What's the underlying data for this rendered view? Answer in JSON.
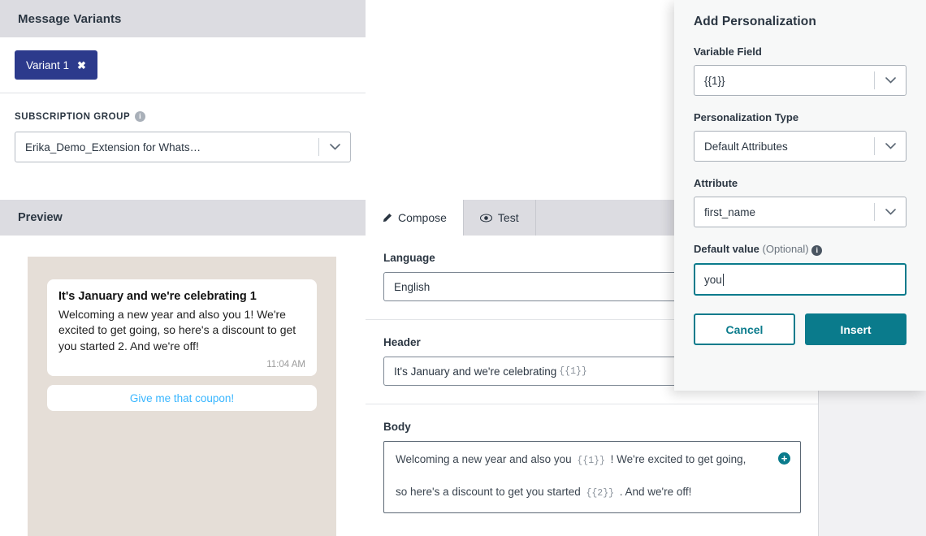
{
  "left": {
    "header_title": "Message Variants",
    "variant_chip": {
      "label": "Variant 1",
      "close_glyph": "✖"
    },
    "subscription": {
      "label": "SUBSCRIPTION GROUP",
      "info_glyph": "i",
      "selected": "Erika_Demo_Extension for Whats…"
    },
    "preview": {
      "title": "Preview",
      "message": {
        "header": "It's January and we're celebrating 1",
        "body": "Welcoming a new year and also you 1! We're excited to get going, so here's a discount to get you started 2. And we're off!",
        "time": "11:04 AM"
      },
      "button_label": "Give me that coupon!"
    }
  },
  "compose": {
    "tabs": [
      {
        "label": "Compose",
        "icon": "pencil-icon",
        "active": true
      },
      {
        "label": "Test",
        "icon": "eye-icon",
        "active": false
      }
    ],
    "language": {
      "label": "Language",
      "value": "English"
    },
    "header": {
      "label": "Header",
      "text": "It's January and we're celebrating",
      "token": "{{1}}"
    },
    "body": {
      "label": "Body",
      "line1_pre": "Welcoming a new year and also you",
      "line1_token": "{{1}}",
      "line1_post": "! We're excited to get going,",
      "line2_pre": "so here's a discount to get you started",
      "line2_token": "{{2}}",
      "line2_post": ". And we're off!",
      "add_glyph": "+"
    }
  },
  "modal": {
    "title": "Add Personalization",
    "variable_field": {
      "label": "Variable Field",
      "value": "{{1}}"
    },
    "personalization_type": {
      "label": "Personalization Type",
      "value": "Default Attributes"
    },
    "attribute": {
      "label": "Attribute",
      "value": "first_name"
    },
    "default_value": {
      "label": "Default value",
      "optional": "(Optional)",
      "info_glyph": "i",
      "value": "you"
    },
    "cancel_label": "Cancel",
    "insert_label": "Insert"
  },
  "colors": {
    "brand_navy": "#2c3a8c",
    "teal": "#0a7b8c",
    "header_gray": "#dcdce1",
    "chat_beige": "#e5ded7",
    "link_blue": "#39b6ff"
  }
}
